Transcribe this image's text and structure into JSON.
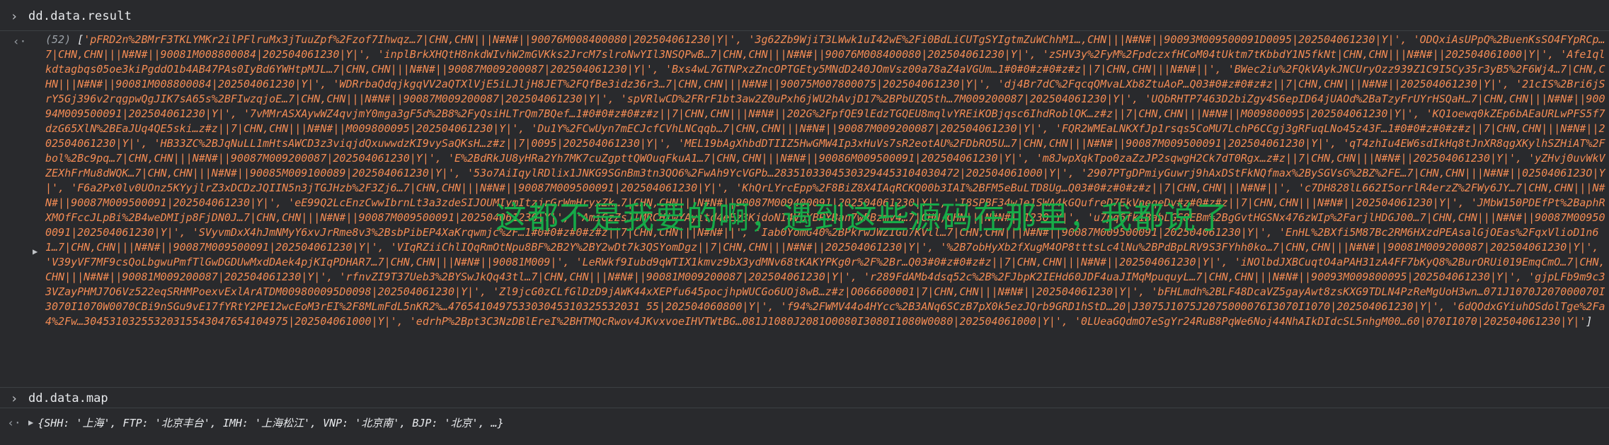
{
  "console": {
    "input1": "dd.data.result",
    "input2": "dd.data.map",
    "prompt_glyph": "›",
    "return_glyph": "‹·",
    "expand_glyph": "▶"
  },
  "result": {
    "length_label": "(52)",
    "open_bracket": "[",
    "close_bracket": "]",
    "entries_text": "'pFRD2n%2BMrF3TKLYMKr2ilPFlruMx3jTuuZpf%2Fzof7Ihwqz…7|CHN,CHN|||N#N#||90076M008400080|202504061230|Y|', '3g62Zb9WjiT3LWwk1uI42wE%2Fi0BdLiCUTgSYIgtmZuWChhM1…,CHN|||N#N#||90093M009500091D0095|202504061230|Y|', 'ODQxiAsUPpQ%2BuenKsSO4FYpRCp…7|CHN,CHN|||N#N#||90081M008800084|202504061230|Y|', 'inplBrkXHQtH8nkdWIvhW2mGVKks2JrcM7slroNwYIl3NSQPwB…7|CHN,CHN|||N#N#||90076M008400080|202504061230|Y|', 'zSHV3y%2FyM%2FpdczxfHCoM04tUktm7tKbbdY1N5fkNt|CHN,CHN|||N#N#||202504061000|Y|', 'Afe1qlkdtagbqs05oe3kiPgddO1b4AB47PAs0IyBd6YWHtpMJL…7|CHN,CHN|||N#N#||90087M009200087|202504061230|Y|', 'Bxs4wL7GTNPxzZncOPTGEty5MNdD240JOmVsz00a78aZ4aVGUm…1#0#0#z#0#z#z||7|CHN,CHN|||N#N#||', 'BWec2iu%2FQkVAykJNCUryOzz939Z1C9I5Cy35r3yB5%2F6Wj4…7|CHN,CHN|||N#N#||90081M008800084|202504061230|Y|', 'WDRrbaQdqjkgqVV2aQTXlVjE5iLJljH8JET%2FQfBe3idz36r3…7|CHN,CHN|||N#N#||90075M007800075|202504061230|Y|', 'dj4Br7dC%2FqcqQMvaLXb8ZtuAoP…Q03#0#z#0#z#z||7|CHN,CHN|||N#N#||202504061230|Y|', '21cIS%2Bri6jSrY5Gj396v2rqgpwQgJIK7sA65s%2BFIwzqjoE…7|CHN,CHN|||N#N#||90087M009200087|202504061230|Y|', 'spVRlwCD%2FRrF1bt3aw2Z0uPxh6jWU2hAvjD17%2BPbUZQ5th…7M009200087|202504061230|Y|', 'UQbRHTP7463D2biZgy4S6epID64jUAOd%2BaTzyFrUYrHSQaH…7|CHN,CHN|||N#N#||90094M009500091|202504061230|Y|', '7vMMrASXAywWZ4qvjmY0mga3gF5d%2B8%2FyQsiHLTrQm7BQef…1#0#0#z#0#z#z||7|CHN,CHN|||N#N#||202G%2FpfQE9lEdzTGQEU8mqlvYREiKOBjqsc6IhdRoblQK…z#z||7|CHN,CHN|||N#N#||M009800095|202504061230|Y|', 'KQ1oewq0kZEp6bAEaURLwPFS5f7dzG65XlN%2BEaJUq4QE5ski…z#z||7|CHN,CHN|||N#N#||M009800095|202504061230|Y|', 'Du1Y%2FCwUyn7mECJcfCVhLNCqqb…7|CHN,CHN|||N#N#||90087M009200087|202504061230|Y|', 'FQR2WMEaLNKXfJp1rsqs5CoMU7LchP6CCgj3gRFuqLNo45z43F…1#0#0#z#0#z#z||7|CHN,CHN|||N#N#||202504061230|Y|', 'HB33ZC%2BJqNuLL1mHtsAWCD3z3viqjdQxuwwdzKI9vySaQKsH…z#z||7|0095|202504061230|Y|', 'MEL19bAgXhbdDTIIZ5HwGMW4Ip3xHuVs7sR2eotAU%2FDbRO5U…7|CHN,CHN|||N#N#||90087M009500091|202504061230|Y|', 'qT4zhIu4EW6sdIkHq8tJnXR8qgXKylhSZHiAT%2Fbol%2Bc9pq…7|CHN,CHN|||N#N#||90087M009200087|202504061230|Y|', 'E%2BdRkJU8yHRa2Yh7MK7cuZgpttQWOuqFkuA1…7|CHN,CHN|||N#N#||90086M009500091|202504061230|Y|', 'm8JwpXqkTpo0zaZzJP2sqwgH2Ck7dT0Rgx…z#z||7|CHN,CHN|||N#N#||202504061230|Y|', 'yZHvj0uvWkVZEXhFrMu8dWQK…7|CHN,CHN|||N#N#||90085M009100089|202504061230|Y|', '53o7AiIqylRDlix1JNKG9SGnBm3tn3QO6%2FwAh9YcVGPb…28351033045303294453104030472|202504061000|Y|', '2907PTgDPmiyGuwrj9hAxDStFkNQfmax%2BySGVsG%2BZ%2FE…7|CHN,CHN|||N#N#||0250406123O|Y|', 'F6a2Px0lv0UOnz5KYyjlrZ3xDCDzJQIIN5n3jTGJHzb%2F3Zj6…7|CHN,CHN|||N#N#||90087M009500091|202504061230|Y|', 'KhQrLYrcEpp%2F8BiZ8X4IAqRCKQ00b3IAI%2BFM5eBuLTD8Ug…Q03#0#z#0#z#z||7|CHN,CHN|||N#N#||', 'c7DH828lL662I5orrlR4erzZ%2FWy6JY…7|CHN,CHN|||N#N#||90087M009500091|202504061230|Y|', 'eE99Q2LcEnzCwwIbrnLt3a3zdeSIJOUMIymItzjrGrWmHryxZk…7|CHN,CHN|||N#N#||90087M009400091|202504061230|Y|', 'I8SPBF34wJe1SWA4kGQufreD7EkVneqeDv#z#0#z#z||7|CHN,CHN|||N#N#||202504061230|Y|', 'JMbW150PDEfPt%2BaphRXMOfFccJLpBi%2B4weDMIjp8FjDN0J…7|CHN,CHN|||N#N#||90087M009500091|202504061230|Y|', 'AmiGzZsJlMRCHiwYAyitd4eEz3KjdoNI4VpYBPYBan7wRBzmy4…7|CHN,CHN|||N#N#||1230|Y|', 'u7pq6fk1BabLGS8EBm%2BgGvtHGSNx476zWIp%2FarjlHDGJ00…7|CHN,CHN|||N#N#||90087M009500091|202504061230|Y|', 'SVyvmDxX4hJmNMyY6xvJrRme8v3%2BsbPibEP4XaKrqwmjc%2F…1#0#0#z#0#z#z||7|CHN,CHN|||N#N#||', 'Iab0YomG40%2BPkrwJWZIGu7KVll…7|CHN,CHN|||N#N#||90087M009500091|202504061230|Y|', 'EnHL%2BXfi5M87Bc2RM6HXzdPEAsalGjOEas%2FqxVlioD1n61…7|CHN,CHN|||N#N#||90087M009500091|202504061230|Y|', 'VIqRZiiChlIQqRmOtNpu8BF%2B2Y%2BY2wDt7k3QSYomDgz||7|CHN,CHN|||N#N#||202504061230|Y|', '%2B7obHyXb2fXugM4OP8tttsLc4lNu%2BPdBpLRV9S3FYhh0ko…7|CHN,CHN|||N#N#||90081M009200087|202504061230|Y|', 'V39yVF7MF9csQoLbgwuPmfTlGwDGDUwMxdDAek4pjKIqPDHAR7…7|CHN,CHN|||N#N#||90081M009|', 'LeRWkf9Iubd9qWTIX1kmvz9bX3ydMNv68tKAKYPKg0r%2F%2Br…Q03#0#z#0#z#z||7|CHN,CHN|||N#N#||202504061230|Y|', 'iNOlbdJXBCuqtO4aPAH31zA4FF7bKyQ8%2BurORUi019EmqCmO…7|CHN,CHN|||N#N#||90081M009200087|202504061230|Y|', 'rfnvZI9T37Ueb3%2BYSwJkQq43tl…7|CHN,CHN|||N#N#||90081M009200087|202504061230|Y|', 'r289FdAMb4dsq52c%2B%2FJbpK2IEHd60JDF4uaJIMqMpuquyL…7|CHN,CHN|||N#N#||90093M009800095|202504061230|Y|', 'gjpLFb9m9c33VZayPHMJ7O6Vz522eqSRHMPoexvExlArATDM009800095D0098|202504061230|Y|', 'Zl9jcG0zCLfGlDzD9jAWK44xXEPfu645pocjhpWUCGo6UOj8wB…z#z|O066600001|7|CHN,CHN|||N#N#||202504061230|Y|', 'bFHLmdh%2BLF48DcaVZ5gayAwt8zsKXG9TDLN4PzReMgUoH3wn…071J1070J207000070I3070I1070W0070CBi9nSGu9vE17fYRtY2PE12wcEoM3rEI%2F8MLmFdL5nKR2%…476541049753303045310325532031 55|202504060800|Y|', 'f94%2FWMV44o4HYcc%2B3ANq6SCzB7pX0k5ezJQrb9GRD1hStD…20|J3075J1075J2075000076I3070I1070|202504061230|Y|', '6dQOdxGYiuhOSdolTge%2Fa4%2Fw…30453103255320315543047654104975|202504061000|Y|', 'edrhP%2Bpt3C3NzDBlEreI%2BHTMQcRwov4JKvxvoeIHVTWtBG…081J1080J2081O0080I3080I1080W0080|202504061000|Y|', '0LUeaGQdmO7eSgYr24RuB8PqWe6Noj44NhAIkDIdcSL5nhgM00…60|070I1070|202504061230|Y|'"
  },
  "map": {
    "preview": "{SHH: '上海', FTP: '北京丰台', IMH: '上海松江', VNP: '北京南', BJP: '北京', …}"
  },
  "watermark": {
    "text": "这都不是我要的啊，遇到这些源码在那里，我都说了"
  },
  "colors": {
    "background": "#292a2d",
    "string": "#f28b54",
    "text": "#e8eaed",
    "muted": "#9aa0a6",
    "watermark": "#14b14a",
    "separator": "#3c4043"
  }
}
